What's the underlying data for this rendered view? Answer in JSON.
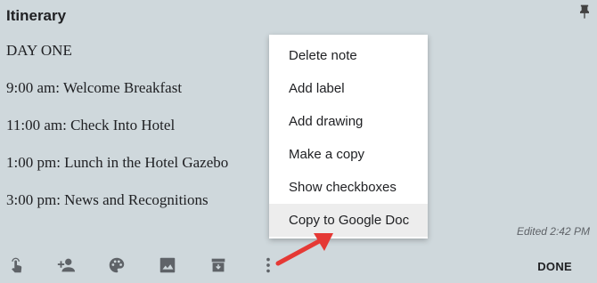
{
  "note": {
    "title": "Itinerary",
    "lines": [
      "DAY ONE",
      "9:00 am: Welcome Breakfast",
      "11:00 am: Check Into Hotel",
      "1:00 pm: Lunch in the Hotel Gazebo",
      "3:00 pm: News and Recognitions"
    ],
    "edited": "Edited 2:42 PM"
  },
  "menu": {
    "items": [
      "Delete note",
      "Add label",
      "Add drawing",
      "Make a copy",
      "Show checkboxes",
      "Copy to Google Doc"
    ],
    "highlighted_index": 5
  },
  "toolbar": {
    "icons": [
      "remind-me-icon",
      "collaborator-icon",
      "palette-icon",
      "image-icon",
      "archive-icon",
      "more-icon"
    ],
    "done_label": "DONE"
  },
  "colors": {
    "note_background": "#cfd8dc",
    "menu_highlight": "#ededed",
    "annotation_arrow": "#e53935"
  }
}
